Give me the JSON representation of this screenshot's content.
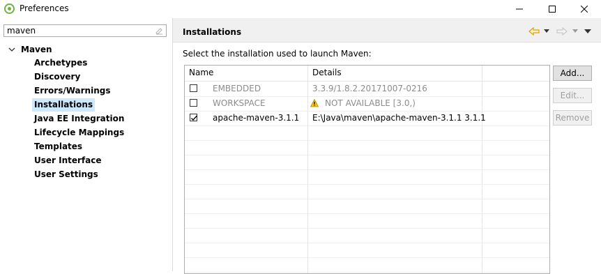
{
  "window": {
    "title": "Preferences",
    "icon": "eclipse-sts-icon",
    "controls": [
      "minimize-icon",
      "maximize-icon",
      "close-icon"
    ]
  },
  "filter": {
    "value": "maven"
  },
  "tree": {
    "parent": "Maven",
    "items": [
      {
        "label": "Archetypes",
        "selected": false
      },
      {
        "label": "Discovery",
        "selected": false
      },
      {
        "label": "Errors/Warnings",
        "selected": false
      },
      {
        "label": "Installations",
        "selected": true
      },
      {
        "label": "Java EE Integration",
        "selected": false
      },
      {
        "label": "Lifecycle Mappings",
        "selected": false
      },
      {
        "label": "Templates",
        "selected": false
      },
      {
        "label": "User Interface",
        "selected": false
      },
      {
        "label": "User Settings",
        "selected": false
      }
    ]
  },
  "page": {
    "title": "Installations",
    "subtitle": "Select the installation used to launch Maven:"
  },
  "table": {
    "columns": [
      "Name",
      "Details"
    ],
    "rows": [
      {
        "checked": false,
        "name": "EMBEDDED",
        "details": "3.3.9/1.8.2.20171007-0216",
        "muted": true,
        "warning": false
      },
      {
        "checked": false,
        "name": "WORKSPACE",
        "details": "NOT AVAILABLE [3.0,)",
        "muted": true,
        "warning": true
      },
      {
        "checked": true,
        "name": "apache-maven-3.1.1",
        "details": "E:\\Java\\maven\\apache-maven-3.1.1 3.1.1",
        "muted": false,
        "warning": false
      }
    ]
  },
  "buttons": {
    "add": "Add...",
    "edit": "Edit...",
    "remove": "Remove"
  },
  "colors": {
    "selection": "#cce8ff",
    "header_bg": "#f0f0f0",
    "muted_text": "#8c8c8c",
    "nav_arrow": "#f0a800"
  }
}
